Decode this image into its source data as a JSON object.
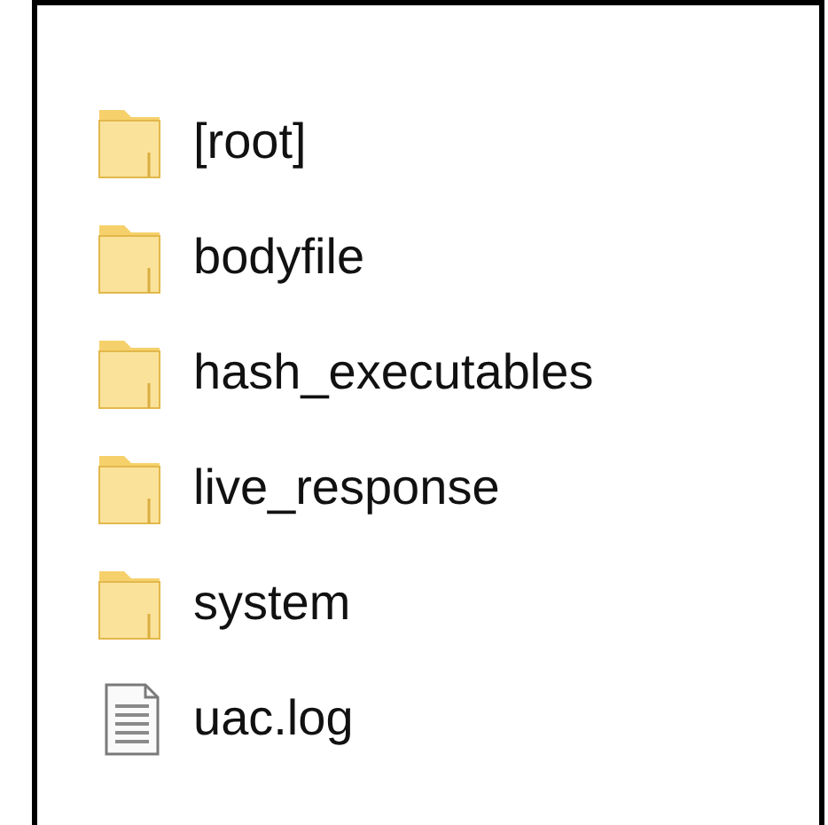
{
  "items": [
    {
      "name": "[root]",
      "kind": "folder"
    },
    {
      "name": "bodyfile",
      "kind": "folder"
    },
    {
      "name": "hash_executables",
      "kind": "folder"
    },
    {
      "name": "live_response",
      "kind": "folder"
    },
    {
      "name": "system",
      "kind": "folder"
    },
    {
      "name": "uac.log",
      "kind": "file"
    }
  ]
}
